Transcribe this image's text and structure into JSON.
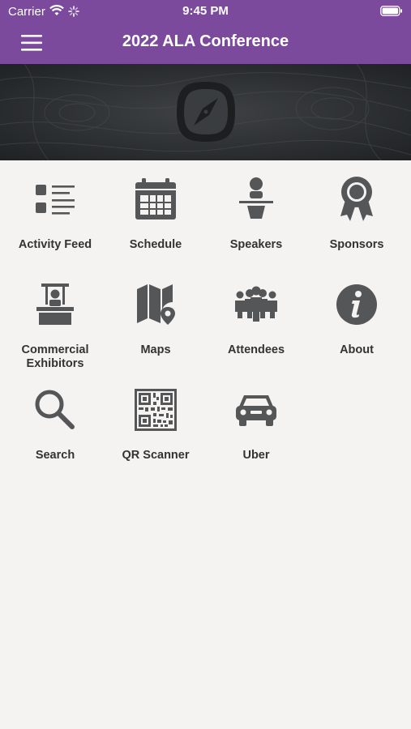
{
  "status_bar": {
    "carrier": "Carrier",
    "time": "9:45 PM"
  },
  "header": {
    "title": "2022 ALA Conference"
  },
  "colors": {
    "header_bg": "#7b4a9c",
    "icon": "#545658",
    "text": "#333333",
    "background": "#f4f3f1"
  },
  "menu": [
    {
      "label": "Activity Feed",
      "icon": "list-icon"
    },
    {
      "label": "Schedule",
      "icon": "calendar-icon"
    },
    {
      "label": "Speakers",
      "icon": "podium-speaker-icon"
    },
    {
      "label": "Sponsors",
      "icon": "ribbon-award-icon"
    },
    {
      "label": "Commercial\nExhibitors",
      "icon": "exhibitor-booth-icon"
    },
    {
      "label": "Maps",
      "icon": "map-pin-icon"
    },
    {
      "label": "Attendees",
      "icon": "people-group-icon"
    },
    {
      "label": "About",
      "icon": "info-icon"
    },
    {
      "label": "Search",
      "icon": "magnifier-icon"
    },
    {
      "label": "QR Scanner",
      "icon": "qr-code-icon"
    },
    {
      "label": "Uber",
      "icon": "car-icon"
    }
  ]
}
